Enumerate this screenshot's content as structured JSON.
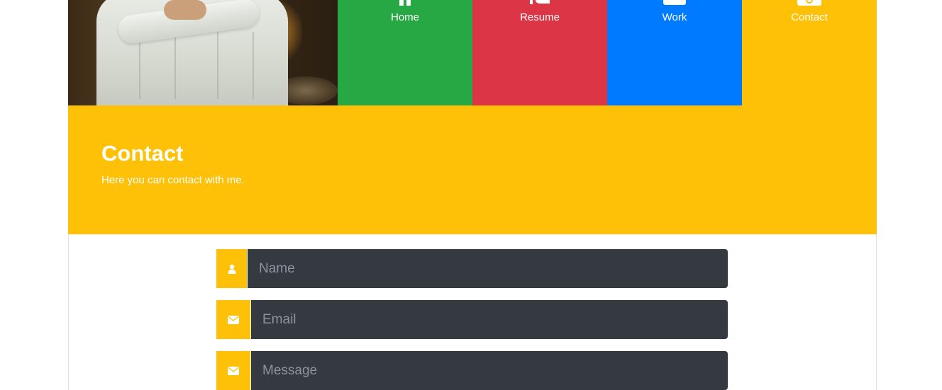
{
  "nav": {
    "items": [
      {
        "label": "Home",
        "icon": "home-icon",
        "color": "#28a745"
      },
      {
        "label": "Resume",
        "icon": "resume-icon",
        "color": "#dc3545"
      },
      {
        "label": "Work",
        "icon": "briefcase-icon",
        "color": "#007bff"
      },
      {
        "label": "Contact",
        "icon": "contact-icon",
        "color": "#ffc107"
      }
    ]
  },
  "section": {
    "title": "Contact",
    "subtitle": "Here you can contact with me."
  },
  "form": {
    "name_placeholder": "Name",
    "email_placeholder": "Email",
    "message_placeholder": "Message"
  },
  "colors": {
    "accent": "#ffc107",
    "input_bg": "#343a40"
  }
}
